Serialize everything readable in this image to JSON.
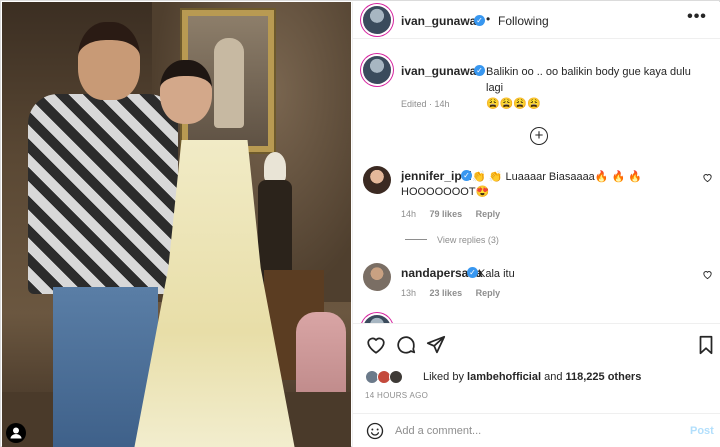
{
  "post": {
    "author": "ivan_gunawan",
    "follow_status": "Following",
    "separator": "•",
    "more_label": "•••",
    "caption_text": "Balikin oo .. oo balikin body gue kaya dulu lagi",
    "caption_emojis": "😩😩😩😩",
    "edited_meta": "Edited · 14h"
  },
  "comments": [
    {
      "username": "jennifer_ipel",
      "text": "👏 👏 Luaaaar Biasaaaa🔥 🔥 🔥",
      "text_line2": "HOOOOOOOT😍",
      "time": "14h",
      "likes": "79 likes",
      "reply": "Reply",
      "view_replies": "View replies (3)"
    },
    {
      "username": "nandapersada",
      "text": "Kala itu",
      "time": "13h",
      "likes": "23 likes",
      "reply": "Reply"
    }
  ],
  "engagement": {
    "liked_by_prefix": "Liked by",
    "liked_by_user": "lambehofficial",
    "liked_by_and": "and",
    "liked_by_count": "118,225 others",
    "timestamp": "14 HOURS AGO"
  },
  "comment_box": {
    "placeholder": "Add a comment...",
    "post_label": "Post"
  },
  "colors": {
    "verified": "#3897f0",
    "story_ring": "#d6249f",
    "muted": "#8e8e8e",
    "post_disabled": "#b2dffc"
  },
  "icons": [
    "heart-icon",
    "comment-icon",
    "share-icon",
    "bookmark-icon",
    "emoji-icon",
    "add-circle-icon",
    "more-icon",
    "verified-icon",
    "user-tag-icon"
  ]
}
